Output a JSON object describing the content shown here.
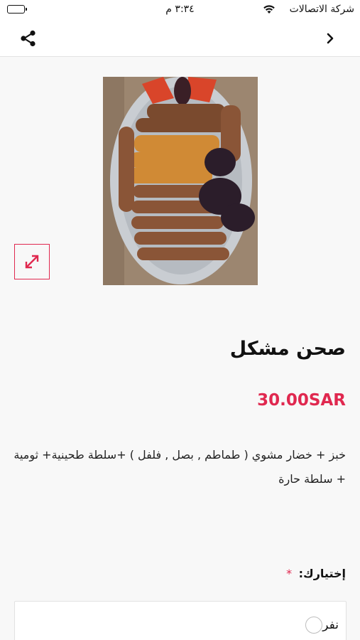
{
  "status_bar": {
    "carrier": "شركة الاتصالات",
    "time": "٣:٣٤ م"
  },
  "nav": {
    "share_icon": "share-icon",
    "back_icon": "chevron-right-icon"
  },
  "product": {
    "image_alt": "mixed grill platter",
    "title": "صحن مشكل",
    "price": "30.00SAR",
    "description": "خبز + خضار مشوي ( طماطم , بصل , فلفل ) +سلطة طحينية+ ثومية + سلطة حارة"
  },
  "choice": {
    "label": "إختيارك:",
    "required_mark": "*",
    "options": [
      {
        "label": "نفر",
        "selected": false
      }
    ]
  },
  "colors": {
    "accent": "#e0284f"
  }
}
